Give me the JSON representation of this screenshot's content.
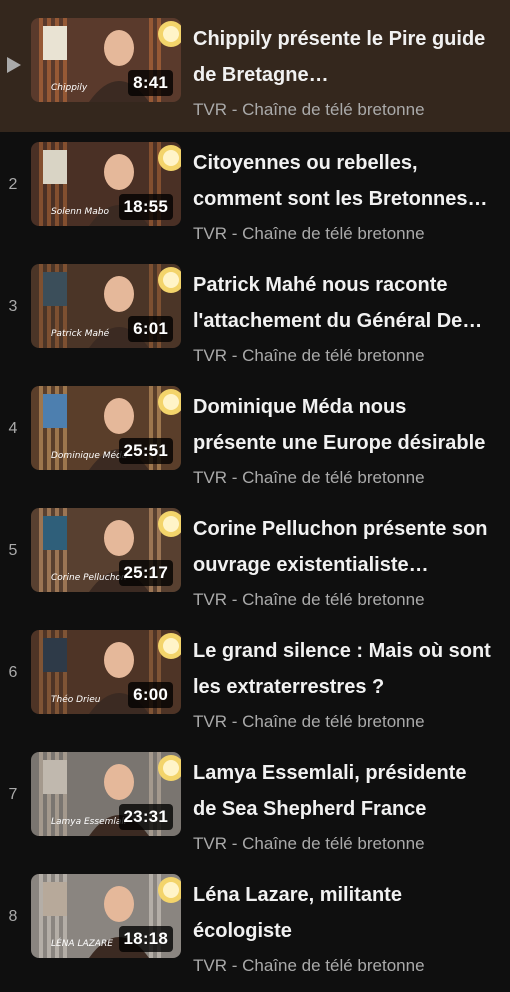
{
  "playlist": {
    "channel_name": "TVR - Chaîne de télé bretonne",
    "items": [
      {
        "index": "",
        "active": true,
        "title": "Chippily présente le Pire guide de Bretagne…",
        "duration": "8:41",
        "thumb_caption": "Chippily",
        "thumb_colors": {
          "bg": "#5a3a2c",
          "accent": "#c9733f",
          "book": "#e9e3d3"
        }
      },
      {
        "index": "2",
        "active": false,
        "title": "Citoyennes ou rebelles, comment sont les Bretonnes…",
        "duration": "18:55",
        "thumb_caption": "Solenn Mabo",
        "thumb_colors": {
          "bg": "#4a3025",
          "accent": "#b36a3a",
          "book": "#d9d4c5"
        }
      },
      {
        "index": "3",
        "active": false,
        "title": "Patrick Mahé nous raconte l'attachement du Général De…",
        "duration": "6:01",
        "thumb_caption": "Patrick Mahé",
        "thumb_colors": {
          "bg": "#4b3527",
          "accent": "#a8663b",
          "book": "#3b4e5a"
        }
      },
      {
        "index": "4",
        "active": false,
        "title": "Dominique Méda nous présente une Europe désirable",
        "duration": "25:51",
        "thumb_caption": "Dominique Méda",
        "thumb_colors": {
          "bg": "#5a3e2a",
          "accent": "#d6a56a",
          "book": "#4d7faf"
        }
      },
      {
        "index": "5",
        "active": false,
        "title": "Corine Pelluchon présente son ouvrage existentialiste…",
        "duration": "25:17",
        "thumb_caption": "Corine Pelluchon",
        "thumb_colors": {
          "bg": "#584030",
          "accent": "#d3a073",
          "book": "#2f5f7a"
        }
      },
      {
        "index": "6",
        "active": false,
        "title": "Le grand silence : Mais où sont les extraterrestres ?",
        "duration": "6:00",
        "thumb_caption": "Théo Drieu",
        "thumb_colors": {
          "bg": "#4e3426",
          "accent": "#a86f43",
          "book": "#2e3a48"
        }
      },
      {
        "index": "7",
        "active": false,
        "title": "Lamya Essemlali, présidente de Sea Shepherd France",
        "duration": "23:31",
        "thumb_caption": "Lamya Essemlali",
        "thumb_colors": {
          "bg": "#7a7570",
          "accent": "#c7b6a6",
          "book": "#c0b8ae"
        }
      },
      {
        "index": "8",
        "active": false,
        "title": "Léna Lazare, militante écologiste",
        "duration": "18:18",
        "thumb_caption": "LÉNA LAZARE",
        "thumb_colors": {
          "bg": "#8a8580",
          "accent": "#d7cfc6",
          "book": "#b7a99a"
        }
      }
    ]
  }
}
